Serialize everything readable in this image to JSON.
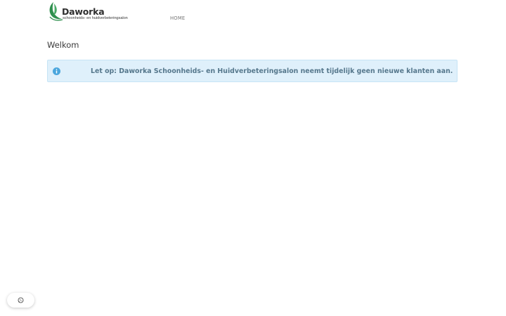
{
  "header": {
    "logo": {
      "name": "Daworka",
      "tagline": "schoonheids- en huidverbeteringsalon"
    },
    "nav": {
      "items": [
        {
          "label": "HOME"
        }
      ]
    }
  },
  "main": {
    "title": "Welkom",
    "alert": {
      "icon": "info-circle-icon",
      "text": "Let op: Daworka Schoonheids- en Huidverbeteringsalon neemt tijdelijk geen nieuwe klanten aan."
    }
  },
  "floating": {
    "icon": "whatsapp-icon"
  },
  "colors": {
    "brand_green": "#2f8f4e",
    "alert_background": "#dff0fb",
    "alert_border": "#c6e4f5",
    "alert_text": "#55778c",
    "info_icon": "#4ba6dd",
    "nav_text": "#777777"
  }
}
